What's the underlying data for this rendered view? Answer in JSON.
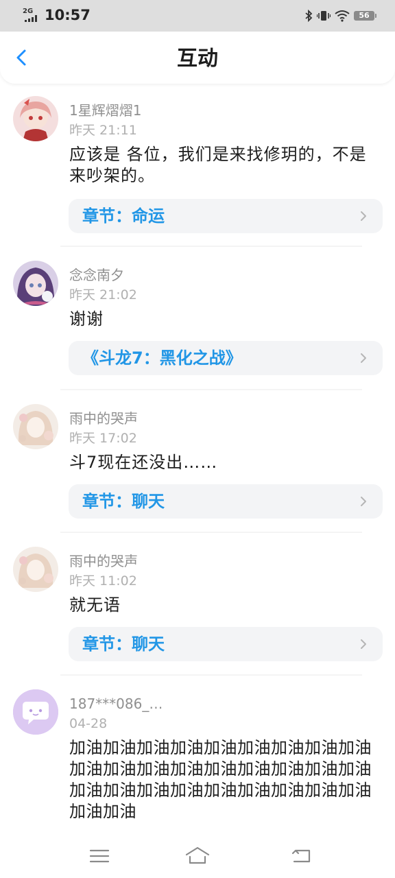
{
  "status_bar": {
    "network": "2G",
    "time": "10:57",
    "battery": "56"
  },
  "header": {
    "title": "互动"
  },
  "comments": [
    {
      "user": "1星辉熠熠1",
      "time": "昨天  21:11",
      "text": "应该是  各位，我们是来找修玥的，不是来吵架的。",
      "link": "章节：命运",
      "avatar": "anime-girl-red-avatar"
    },
    {
      "user": "念念南夕",
      "time": "昨天  21:02",
      "text": "谢谢",
      "link": "《斗龙7：黑化之战》",
      "avatar": "anime-girl-purple-avatar"
    },
    {
      "user": "雨中的哭声",
      "time": "昨天  17:02",
      "text": "斗7现在还没出……",
      "link": "章节：聊天",
      "avatar": "anime-girl-pastel-avatar"
    },
    {
      "user": "雨中的哭声",
      "time": "昨天  11:02",
      "text": "就无语",
      "link": "章节：聊天",
      "avatar": "anime-girl-pastel-avatar"
    },
    {
      "user": "187***086_…",
      "time": "04-28",
      "text": "加油加油加油加油加油加油加油加油加油加油加油加油加油加油加油加油加油加油加油加油加油加油加油加油加油加油加油加油加油",
      "avatar": "chat-bubble-avatar"
    }
  ],
  "nav_bar": {
    "menu": "menu-icon",
    "home": "home-icon",
    "back": "back-icon"
  },
  "colors": {
    "link": "#2196e6",
    "back_arrow": "#1e90ff",
    "chip_bg": "#f3f4f6"
  }
}
